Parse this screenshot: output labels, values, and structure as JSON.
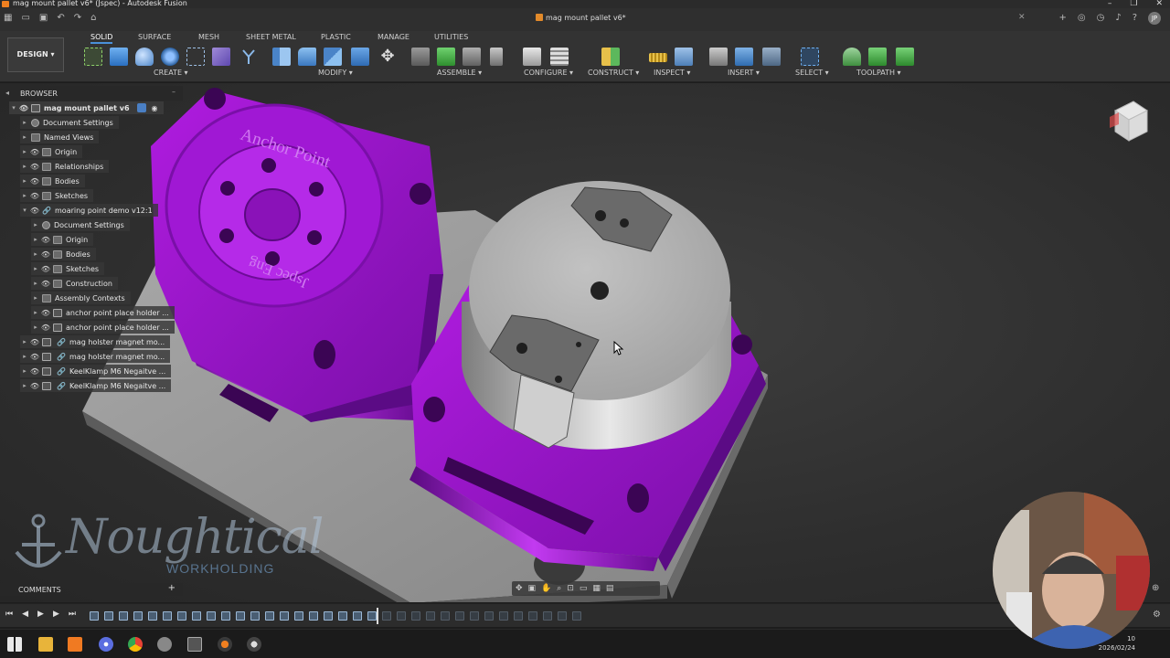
{
  "window": {
    "title": "mag mount pallet v6* (Jspec) - Autodesk Fusion",
    "controls": [
      "–",
      "❐",
      "✕"
    ]
  },
  "document_tab": {
    "label": "mag mount pallet v6*"
  },
  "user": {
    "initials": "JP"
  },
  "workspace": {
    "label": "DESIGN ▾"
  },
  "ribbon": {
    "tabs": [
      "SOLID",
      "SURFACE",
      "MESH",
      "SHEET METAL",
      "PLASTIC",
      "MANAGE",
      "UTILITIES"
    ],
    "active_tab": "SOLID",
    "groups": [
      "CREATE ▾",
      "MODIFY ▾",
      "ASSEMBLE ▾",
      "CONFIGURE ▾",
      "CONSTRUCT ▾",
      "INSPECT ▾",
      "INSERT ▾",
      "SELECT ▾",
      "TOOLPATH ▾"
    ]
  },
  "browser": {
    "header": "BROWSER",
    "root": "mag mount pallet v6",
    "items": [
      "Document Settings",
      "Named Views",
      "Origin",
      "Relationships",
      "Bodies",
      "Sketches",
      "moaring point demo v12:1",
      "Document Settings",
      "Origin",
      "Bodies",
      "Sketches",
      "Construction",
      "Assembly Contexts",
      "anchor point place holder ...",
      "anchor point place holder ...",
      "mag holster magnet mo...",
      "mag holster magnet mo...",
      "KeelKlamp M6 Negaitve ...",
      "KeelKlamp M6 Negaitve ..."
    ]
  },
  "model": {
    "emboss_top": "Anchor Point",
    "emboss_bottom": "Jspec Eng"
  },
  "comments": {
    "label": "COMMENTS",
    "add": "+"
  },
  "logo": {
    "main": "Noughtical",
    "sub": "WORKHOLDING"
  },
  "taskbar": {
    "time": "10",
    "date": "2026/02/24"
  },
  "colors": {
    "accent": "#4a90d9",
    "purple_body": "#9b16c8",
    "grey_body": "#8c8c8c"
  }
}
